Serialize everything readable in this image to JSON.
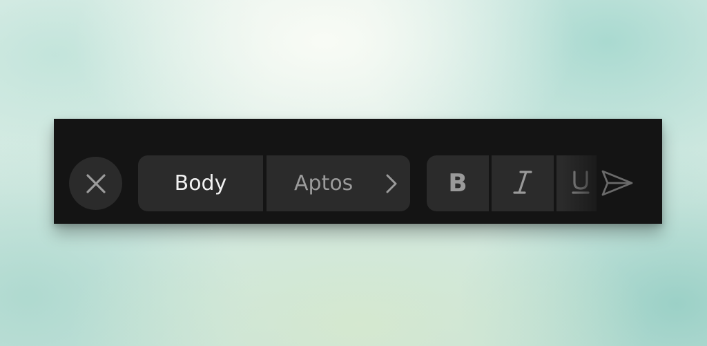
{
  "toolbar": {
    "close_icon": "xmark-icon",
    "style_label": "Body",
    "font_label": "Aptos",
    "font_chevron_icon": "chevron-right-icon",
    "bold_label": "B",
    "italic_icon": "italic-icon",
    "underline_icon": "underline-icon",
    "send_icon": "paper-plane-icon"
  },
  "colors": {
    "toolbar_bg": "#141414",
    "button_bg": "#2b2b2b",
    "primary_text": "#f1f1f1",
    "secondary_text": "#9b9b9b"
  }
}
